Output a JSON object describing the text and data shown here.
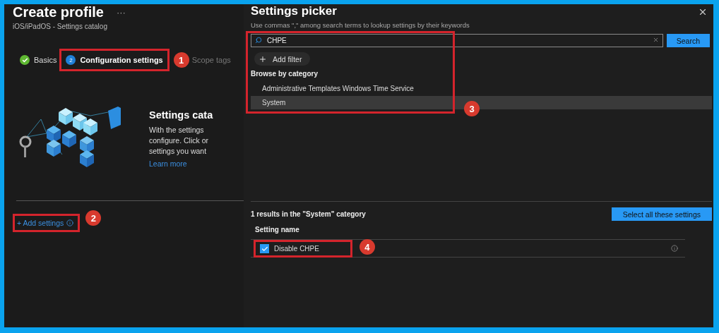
{
  "page": {
    "title": "Create profile",
    "more": "···",
    "subtitle": "iOS/iPadOS - Settings catalog"
  },
  "steps": [
    {
      "label": "Basics",
      "kind": "done",
      "selected": false
    },
    {
      "label": "Configuration settings",
      "number": "2",
      "kind": "current",
      "selected": true
    },
    {
      "label": "Scope tags",
      "kind": "pending",
      "selected": false
    }
  ],
  "intro": {
    "heading": "Settings cata",
    "lines": [
      "With the settings",
      "configure. Click or",
      "settings you want"
    ],
    "link": "Learn more"
  },
  "add_settings": {
    "label": "+ Add settings"
  },
  "picker": {
    "title": "Settings picker",
    "hint": "Use commas \",\" among search terms to lookup settings by their keywords",
    "search": {
      "value": "CHPE"
    },
    "search_button": "Search",
    "add_filter": "Add filter",
    "browse_heading": "Browse by category",
    "categories": [
      {
        "label": "Administrative Templates Windows Time Service",
        "selected": false
      },
      {
        "label": "System",
        "selected": true
      }
    ],
    "results_summary": "1 results in the \"System\" category",
    "select_all": "Select all these settings",
    "column": "Setting name",
    "settings": [
      {
        "name": "Disable CHPE",
        "checked": true
      }
    ]
  },
  "annotations": [
    {
      "number": "1"
    },
    {
      "number": "2"
    },
    {
      "number": "3"
    },
    {
      "number": "4"
    }
  ]
}
